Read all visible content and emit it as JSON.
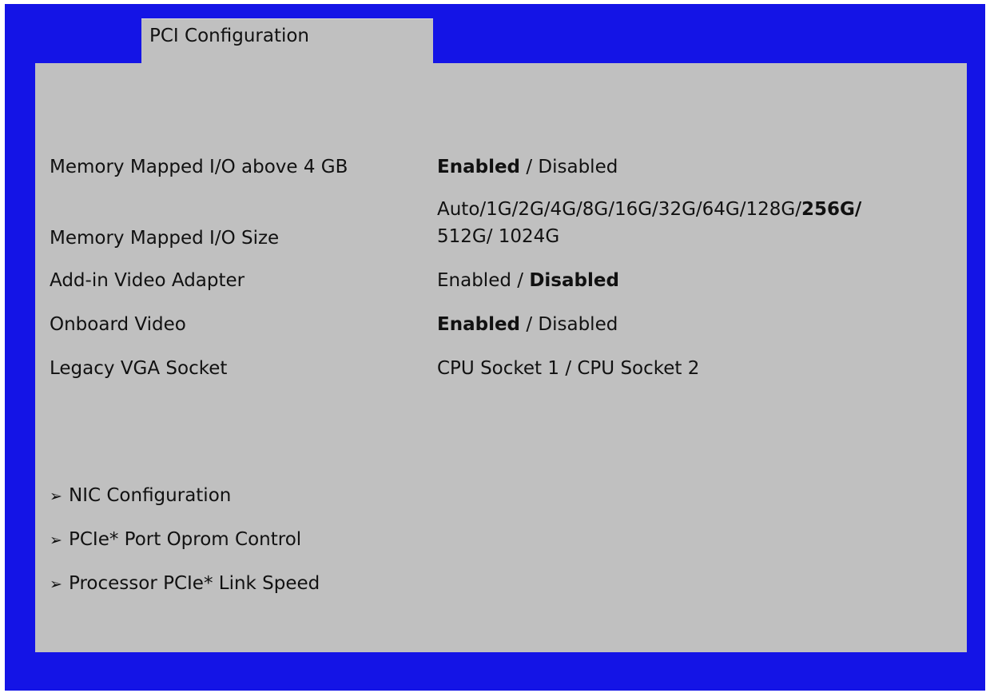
{
  "window": {
    "tab_title": "PCI Configuration"
  },
  "settings": [
    {
      "label": "Memory Mapped I/O above 4 GB",
      "options": [
        {
          "text": "Enabled",
          "bold": true
        },
        {
          "text": " / ",
          "bold": false
        },
        {
          "text": "Disabled",
          "bold": false
        }
      ]
    },
    {
      "label": "Memory Mapped I/O Size",
      "options_line1": [
        {
          "text": "Auto/1G/2G/4G/8G/16G/32G/64G/128G/",
          "bold": false
        },
        {
          "text": "256G/",
          "bold": true
        }
      ],
      "options_line2": "512G/ 1024G"
    },
    {
      "label": "Add-in Video Adapter",
      "options": [
        {
          "text": "Enabled",
          "bold": false
        },
        {
          "text": " / ",
          "bold": false
        },
        {
          "text": "Disabled",
          "bold": true
        }
      ]
    },
    {
      "label": "Onboard Video",
      "options": [
        {
          "text": "Enabled",
          "bold": true
        },
        {
          "text": " / ",
          "bold": false
        },
        {
          "text": "Disabled",
          "bold": false
        }
      ]
    },
    {
      "label": "Legacy VGA Socket",
      "options": [
        {
          "text": "CPU Socket 1 / CPU Socket 2",
          "bold": false
        }
      ]
    }
  ],
  "submenus": [
    {
      "arrow": "➢",
      "label": "NIC Configuration"
    },
    {
      "arrow": "➢",
      "label": "PCIe* Port Oprom Control"
    },
    {
      "arrow": "➢",
      "label": "Processor PCIe* Link Speed"
    }
  ],
  "colors": {
    "frame": "#1414e6",
    "panel": "#c0c0c0"
  }
}
